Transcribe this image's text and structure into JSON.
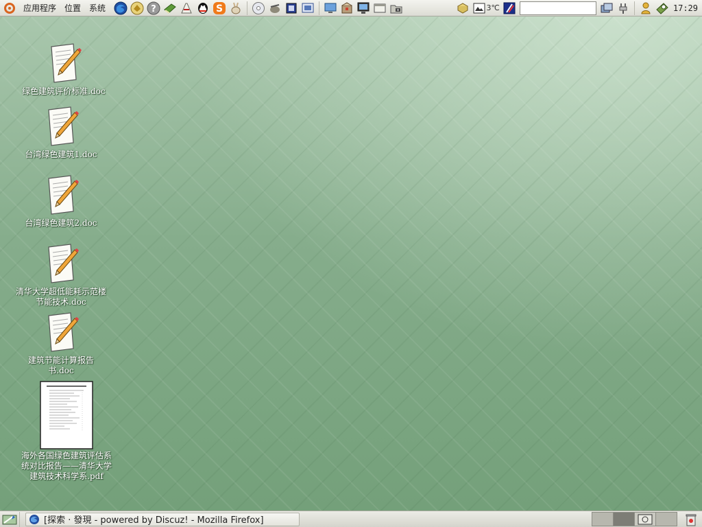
{
  "top_panel": {
    "menus": [
      {
        "label": "应用程序"
      },
      {
        "label": "位置"
      },
      {
        "label": "系统"
      }
    ],
    "launchers": [
      {
        "icon": "firefox-icon"
      },
      {
        "icon": "evolution-icon"
      },
      {
        "icon": "help-icon"
      },
      {
        "icon": "book-icon"
      },
      {
        "icon": "dictionary-icon"
      },
      {
        "icon": "qq-icon"
      },
      {
        "icon": "skype-icon"
      },
      {
        "icon": "rabbit-icon"
      },
      {
        "icon": "disc-icon"
      },
      {
        "icon": "gimp-icon"
      },
      {
        "icon": "chip-icon"
      },
      {
        "icon": "screenshot-icon"
      },
      {
        "icon": "remote-desktop-icon"
      },
      {
        "icon": "package-icon"
      },
      {
        "icon": "monitor-icon"
      },
      {
        "icon": "window-icon"
      },
      {
        "icon": "folder-camera-icon"
      }
    ],
    "tray": {
      "temperature": "3℃",
      "search_value": "",
      "clock": "17:29"
    }
  },
  "desktop": {
    "icons": [
      {
        "name": "绿色建筑评价标准.doc",
        "type": "doc"
      },
      {
        "name": "台湾绿色建筑1.doc",
        "type": "doc"
      },
      {
        "name": "台湾绿色建筑2.doc",
        "type": "doc"
      },
      {
        "name": "清华大学超低能耗示范楼节能技术.doc",
        "type": "doc"
      },
      {
        "name": "建筑节能计算报告书.doc",
        "type": "doc"
      },
      {
        "name": "海外各国绿色建筑评估系统对比报告——清华大学建筑技术科学系.pdf",
        "type": "pdf"
      }
    ]
  },
  "bottom_panel": {
    "tasks": [
      {
        "label": "[探索 · 發現  - powered by Discuz! - Mozilla Firefox]"
      }
    ],
    "workspaces": [
      {
        "state": "normal"
      },
      {
        "state": "active"
      },
      {
        "state": "window"
      },
      {
        "state": "normal"
      }
    ]
  },
  "colors": {
    "desktop_green": "#86ad8c",
    "panel_gray": "#dcdcd4",
    "ubuntu_orange": "#d9641f"
  }
}
